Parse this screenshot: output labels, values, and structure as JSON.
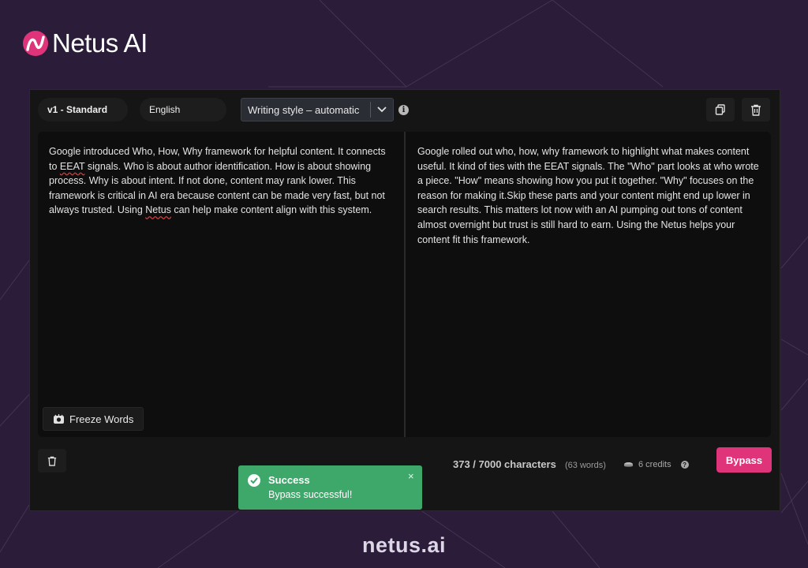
{
  "brand": {
    "name": "Netus AI"
  },
  "toolbar": {
    "version": "v1 - Standard",
    "language": "English",
    "writing_style": "Writing style – automatic"
  },
  "input": {
    "text_before_1": "Google introduced Who, How, Why framework for helpful content. It connects to ",
    "eeat": "EEAT",
    "text_after_eeat": " signals. Who is about author identification. How is about showing process. Why is about intent. If not done, content may rank lower. This framework is critical in AI era because content can be made very fast, but not always trusted. Using ",
    "netus": "Netus",
    "text_end": " can help make content align with this system."
  },
  "output": {
    "text": "Google rolled out who, how, why framework to highlight what makes content useful. It kind of ties with the EEAT signals. The \"Who\" part looks at who wrote a piece. \"How\" means showing how you put it together. \"Why\" focuses on the reason for making it.Skip these parts and your content might end up lower in search results. This matters lot now with an AI pumping out tons of content almost overnight but trust is still hard to earn. Using the Netus helps your content fit this framework."
  },
  "actions": {
    "freeze_words": "Freeze Words",
    "bypass": "Bypass"
  },
  "stats": {
    "characters": "373 / 7000 characters",
    "words": "(63 words)",
    "credits": "6 credits"
  },
  "toast": {
    "title": "Success",
    "message": "Bypass successful!",
    "close": "×"
  },
  "footer": {
    "site": "netus.ai"
  },
  "colors": {
    "background": "#2b1c3a",
    "accent": "#e0347a",
    "success": "#3ea86a"
  }
}
